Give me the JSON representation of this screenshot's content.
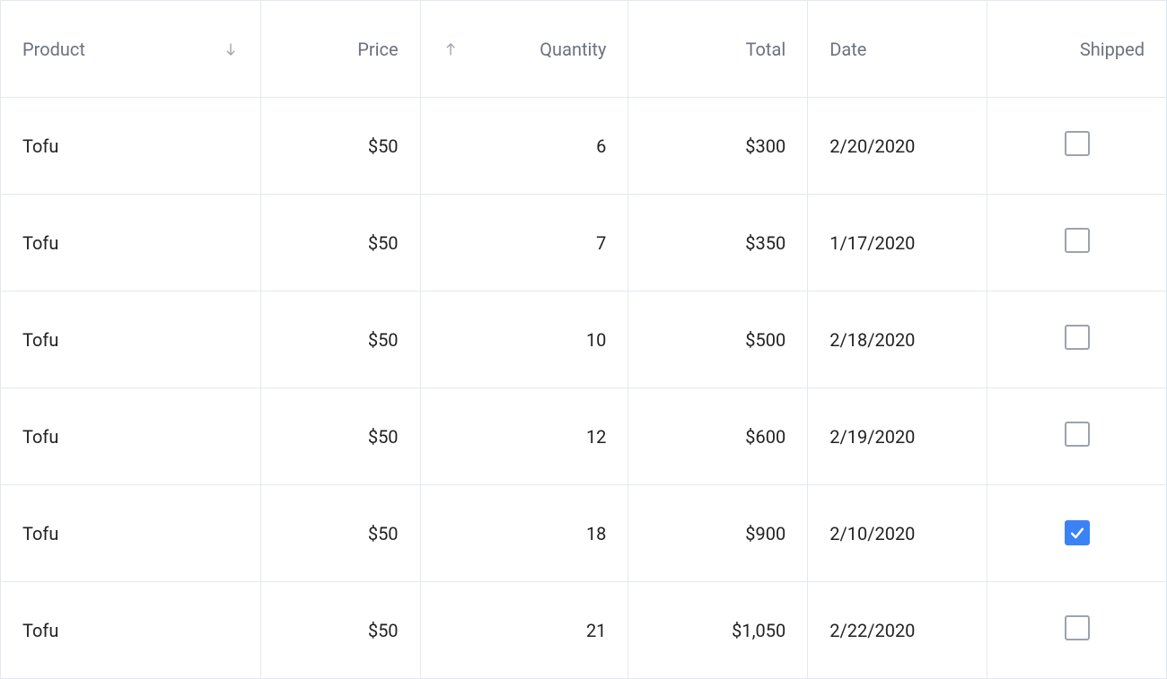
{
  "table": {
    "headers": {
      "product": "Product",
      "price": "Price",
      "quantity": "Quantity",
      "total": "Total",
      "date": "Date",
      "shipped": "Shipped"
    },
    "rows": [
      {
        "product": "Tofu",
        "price": "$50",
        "quantity": "6",
        "total": "$300",
        "date": "2/20/2020",
        "shipped": false
      },
      {
        "product": "Tofu",
        "price": "$50",
        "quantity": "7",
        "total": "$350",
        "date": "1/17/2020",
        "shipped": false
      },
      {
        "product": "Tofu",
        "price": "$50",
        "quantity": "10",
        "total": "$500",
        "date": "2/18/2020",
        "shipped": false
      },
      {
        "product": "Tofu",
        "price": "$50",
        "quantity": "12",
        "total": "$600",
        "date": "2/19/2020",
        "shipped": false
      },
      {
        "product": "Tofu",
        "price": "$50",
        "quantity": "18",
        "total": "$900",
        "date": "2/10/2020",
        "shipped": true
      },
      {
        "product": "Tofu",
        "price": "$50",
        "quantity": "21",
        "total": "$1,050",
        "date": "2/22/2020",
        "shipped": false
      }
    ]
  }
}
